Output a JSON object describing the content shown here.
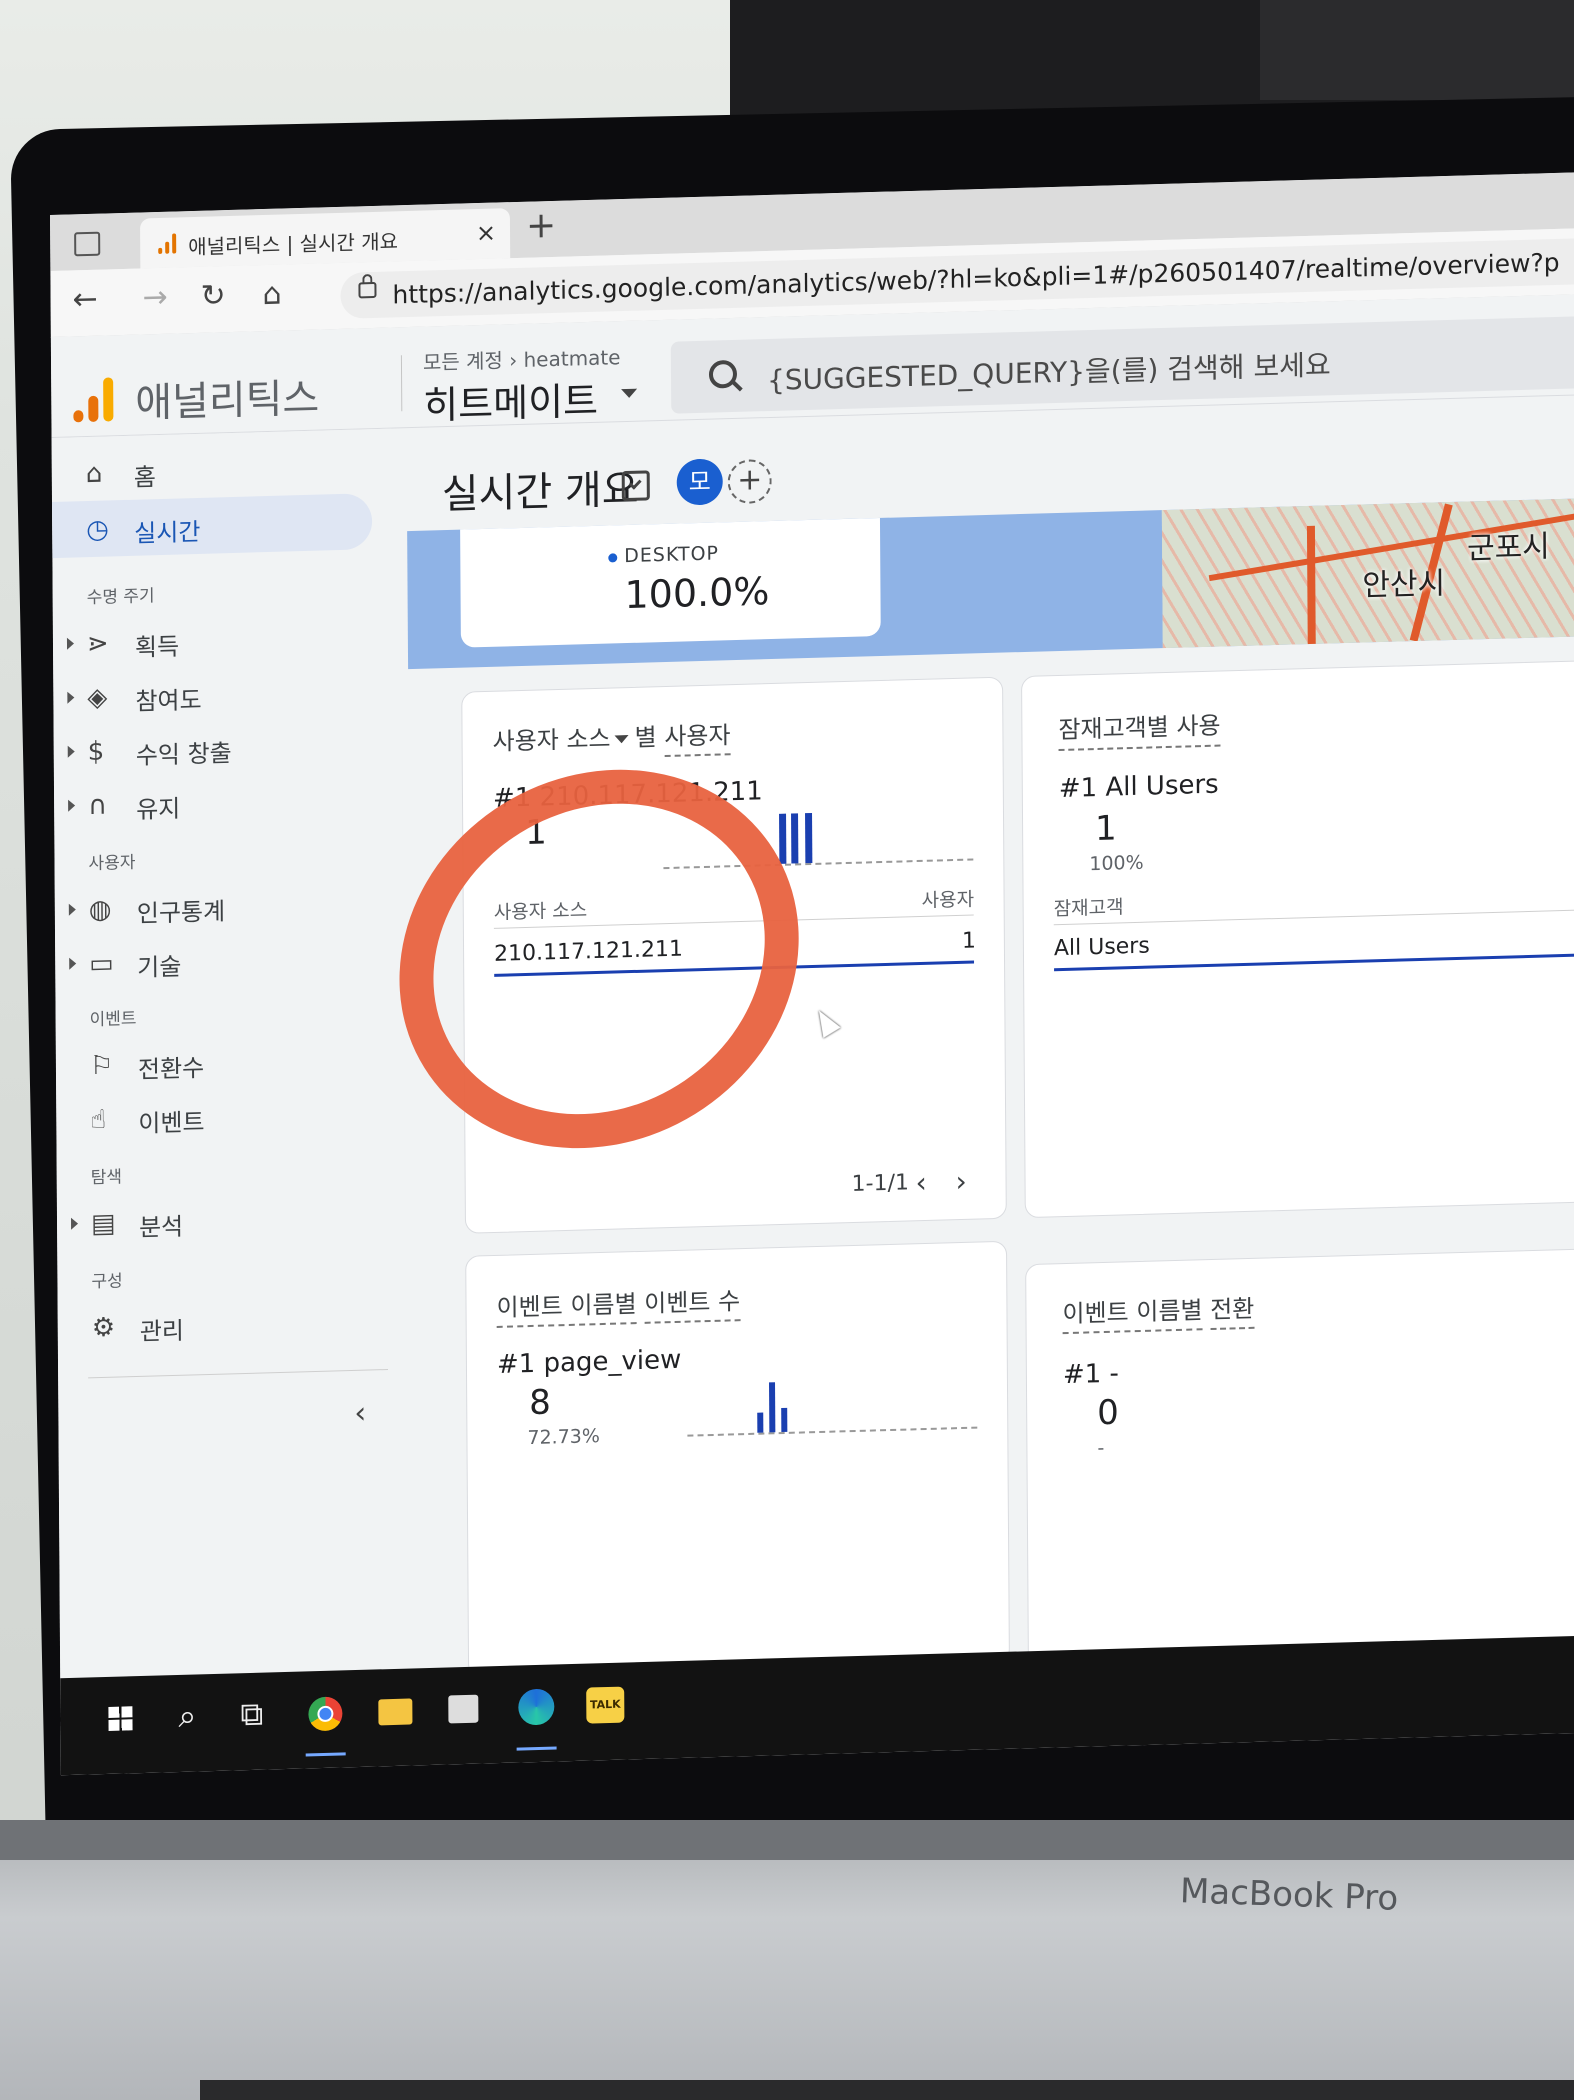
{
  "browser": {
    "tab_title": "애널리틱스 | 실시간 개요",
    "tab_close": "×",
    "new_tab": "+",
    "url": "https://analytics.google.com/analytics/web/?hl=ko&pli=1#/p260501407/realtime/overview?p"
  },
  "header": {
    "app_name": "애널리틱스",
    "breadcrumb": "모든 계정 › heatmate",
    "property": "히트메이트",
    "search_placeholder": "{SUGGESTED_QUERY}을(를) 검색해 보세요"
  },
  "sidebar": {
    "home": "홈",
    "realtime": "실시간",
    "sections": {
      "lifecycle": "수명 주기",
      "user": "사용자",
      "events": "이벤트",
      "explore": "탐색",
      "configure": "구성"
    },
    "items": {
      "acquisition": "획득",
      "engagement": "참여도",
      "monetization": "수익 창출",
      "retention": "유지",
      "demographics": "인구통계",
      "tech": "기술",
      "conversions": "전환수",
      "events": "이벤트",
      "analysis": "분석",
      "admin": "관리"
    },
    "collapse": "‹"
  },
  "main": {
    "title": "실시간 개요",
    "avatar": "모",
    "add": "+"
  },
  "map": {
    "city1": "안산시",
    "city2": "군포시",
    "device_label": "DESKTOP",
    "device_value": "100.0%"
  },
  "card_source": {
    "title_dim": "사용자 소스",
    "title_sep": "별",
    "title_metric": "사용자",
    "rank": "#1  210.117.121.211",
    "value": "1",
    "col_dim": "사용자 소스",
    "col_metric": "사용자",
    "row_dim": "210.117.121.211",
    "row_value": "1",
    "pager": "1-1/1",
    "prev": "‹",
    "next": "›"
  },
  "card_audience": {
    "title": "잠재고객별 사용",
    "rank": "#1  All Users",
    "value": "1",
    "pct": "100%",
    "col_dim": "잠재고객",
    "row_dim": "All Users"
  },
  "card_events": {
    "title_a": "이벤트 이름별",
    "title_b": "이벤트 수",
    "rank": "#1  page_view",
    "value": "8",
    "pct": "72.73%"
  },
  "card_conversions": {
    "title_a": "이벤트 이름별",
    "title_b": "전환",
    "rank": "#1  -",
    "value": "0",
    "dash": "-"
  },
  "laptop": {
    "brand": "MacBook Pro"
  },
  "taskbar": {
    "talk": "TALK"
  }
}
